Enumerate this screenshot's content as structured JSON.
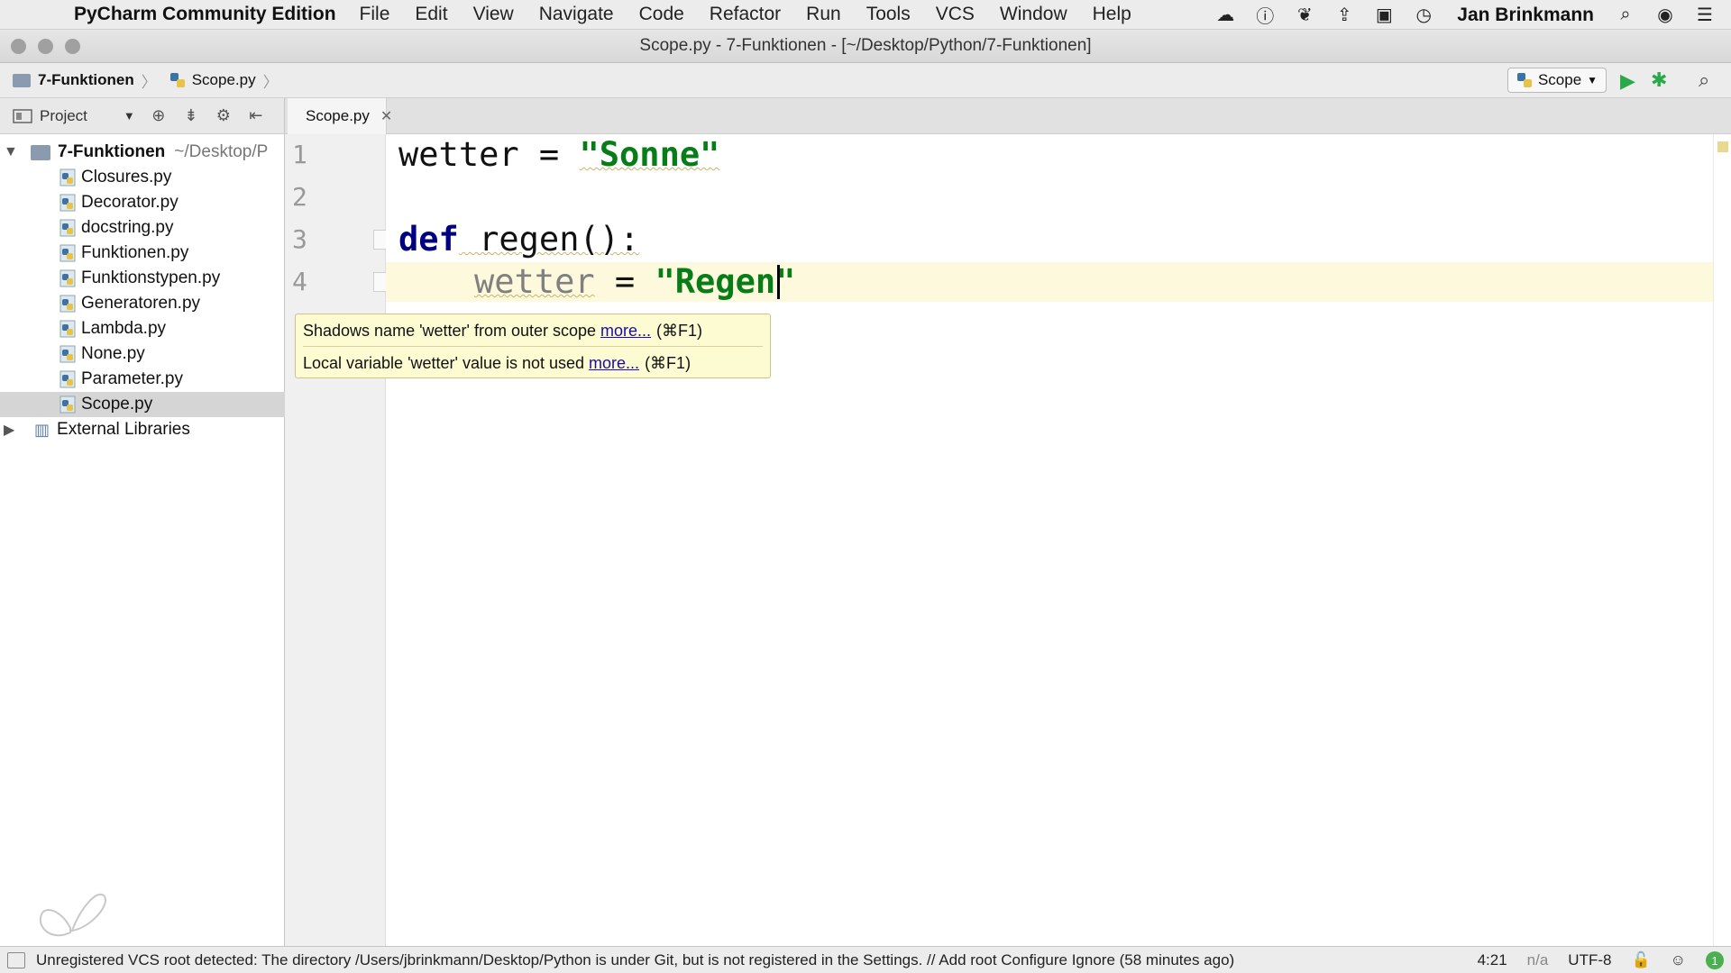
{
  "menubar": {
    "app_name": "PyCharm Community Edition",
    "items": [
      "File",
      "Edit",
      "View",
      "Navigate",
      "Code",
      "Refactor",
      "Run",
      "Tools",
      "VCS",
      "Window",
      "Help"
    ],
    "user": "Jan Brinkmann",
    "tray_icons": [
      "creative-cloud-icon",
      "onepassword-icon",
      "leaf-icon",
      "upload-icon",
      "video-icon",
      "time-machine-icon",
      "spotlight-icon",
      "siri-icon",
      "notification-center-icon"
    ]
  },
  "titlebar": {
    "title": "Scope.py - 7-Funktionen - [~/Desktop/Python/7-Funktionen]"
  },
  "navbar": {
    "breadcrumb": [
      "7-Funktionen",
      "Scope.py"
    ],
    "run_config": "Scope"
  },
  "project_panel": {
    "header_label": "Project",
    "root": {
      "name": "7-Funktionen",
      "path": "~/Desktop/P"
    },
    "files": [
      "Closures.py",
      "Decorator.py",
      "docstring.py",
      "Funktionen.py",
      "Funktionstypen.py",
      "Generatoren.py",
      "Lambda.py",
      "None.py",
      "Parameter.py",
      "Scope.py"
    ],
    "selected_file": "Scope.py",
    "external_libraries": "External Libraries"
  },
  "editor": {
    "tab": "Scope.py",
    "line_numbers": [
      "1",
      "2",
      "3",
      "4"
    ],
    "code": {
      "l1_var": "wetter",
      "l1_op": " = ",
      "l1_str": "\"Sonne\"",
      "l3_kw": "def",
      "l3_fn": " regen():",
      "l4_var": "wetter",
      "l4_op": " = ",
      "l4_str": "\"Regen\""
    }
  },
  "tooltip": {
    "line1": "Shadows name 'wetter' from outer scope",
    "line2": "Local variable 'wetter' value is not used",
    "more": "more...",
    "shortcut": "(⌘F1)"
  },
  "statusbar": {
    "message": "Unregistered VCS root detected: The directory /Users/jbrinkmann/Desktop/Python is under Git, but is not registered in the Settings. // Add root  Configure  Ignore (58 minutes ago)",
    "position": "4:21",
    "na": "n/a",
    "encoding": "UTF-8",
    "badge": "1"
  },
  "colors": {
    "keyword": "#000080",
    "string": "#067d17",
    "current_line": "#fdf9dd",
    "tooltip_bg": "#fdfbd2",
    "run_green": "#2aa84a"
  }
}
